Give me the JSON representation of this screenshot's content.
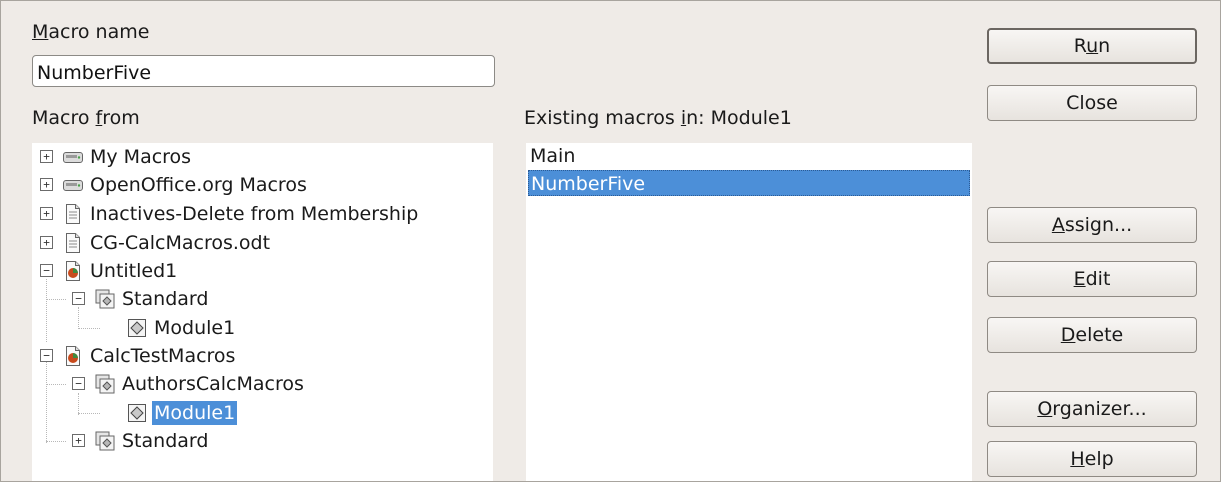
{
  "labels": {
    "macro_name_mn": "M",
    "macro_name_rest": "acro name",
    "macro_from_pre": "Macro ",
    "macro_from_mn": "f",
    "macro_from_post": "rom",
    "existing_pre": "Existing macros ",
    "existing_mn": "i",
    "existing_post": "n: Module1"
  },
  "macro_name_value": "NumberFive",
  "tree": [
    {
      "label": "My Macros",
      "icon": "drive-icon",
      "expander": "+"
    },
    {
      "label": "OpenOffice.org Macros",
      "icon": "drive-icon",
      "expander": "+"
    },
    {
      "label": "Inactives-Delete from Membership",
      "icon": "document-icon",
      "expander": "+"
    },
    {
      "label": "CG-CalcMacros.odt",
      "icon": "document-icon",
      "expander": "+"
    },
    {
      "label": "Untitled1",
      "icon": "spreadsheet-icon",
      "expander": "−"
    },
    {
      "label": "Standard",
      "icon": "library-icon",
      "expander": "−"
    },
    {
      "label": "Module1",
      "icon": "module-icon",
      "expander": ""
    },
    {
      "label": "CalcTestMacros",
      "icon": "spreadsheet-icon",
      "expander": "−"
    },
    {
      "label": "AuthorsCalcMacros",
      "icon": "library-icon",
      "expander": "−"
    },
    {
      "label": "Module1",
      "icon": "module-icon",
      "expander": "",
      "selected": true
    },
    {
      "label": "Standard",
      "icon": "library-icon",
      "expander": "+"
    }
  ],
  "macros": [
    {
      "label": "Main"
    },
    {
      "label": "NumberFive",
      "selected": true
    }
  ],
  "buttons": {
    "run_pre": "R",
    "run_mn": "u",
    "run_post": "n",
    "close": "Close",
    "assign_mn": "A",
    "assign_post": "ssign...",
    "edit_mn": "E",
    "edit_post": "dit",
    "delete_mn": "D",
    "delete_post": "elete",
    "organizer_mn": "O",
    "organizer_post": "rganizer...",
    "help_mn": "H",
    "help_post": "elp"
  },
  "colors": {
    "selection": "#4c8fd8",
    "dialog_bg": "#efebe7"
  }
}
